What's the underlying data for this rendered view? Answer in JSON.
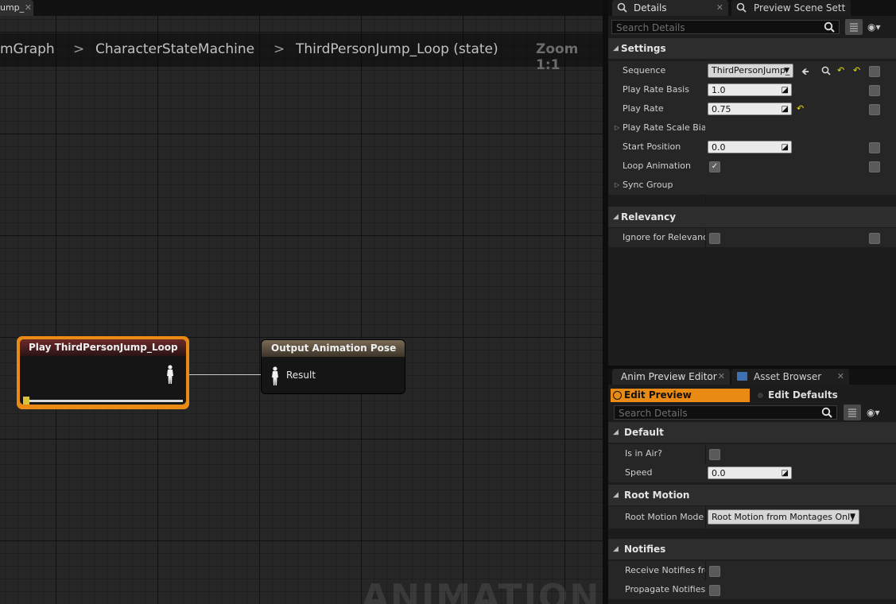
{
  "graph": {
    "tab_label": "ump_",
    "tab_close": "✕",
    "breadcrumb": [
      "mGraph",
      "CharacterStateMachine",
      "ThirdPersonJump_Loop (state)"
    ],
    "breadcrumb_sep": ">",
    "zoom": "Zoom 1:1",
    "watermark": "ANIMATION",
    "node_play_title": "Play ThirdPersonJump_Loop",
    "node_output_title": "Output Animation Pose",
    "node_output_pin": "Result"
  },
  "details_panel": {
    "tab_details": "Details",
    "tab_preview_scene": "Preview Scene Sett",
    "search_placeholder": "Search Details",
    "sections": {
      "settings": "Settings",
      "relevancy": "Relevancy"
    },
    "rows": {
      "sequence": {
        "label": "Sequence",
        "value": "ThirdPersonJump_"
      },
      "play_rate_basis": {
        "label": "Play Rate Basis",
        "value": "1.0"
      },
      "play_rate": {
        "label": "Play Rate",
        "value": "0.75"
      },
      "play_rate_scale_bias": {
        "label": "Play Rate Scale Bias"
      },
      "start_position": {
        "label": "Start Position",
        "value": "0.0"
      },
      "loop_animation": {
        "label": "Loop Animation",
        "checked": true
      },
      "sync_group": {
        "label": "Sync Group"
      },
      "ignore_for_relevancy": {
        "label": "Ignore for Relevancy",
        "checked": false
      }
    }
  },
  "anim_preview_panel": {
    "tab_anim_preview": "Anim Preview Editor",
    "tab_asset_browser": "Asset Browser",
    "edit_preview": "Edit Preview",
    "edit_defaults": "Edit Defaults",
    "search_placeholder": "Search Details",
    "sections": {
      "default": "Default",
      "root_motion": "Root Motion",
      "notifies": "Notifies"
    },
    "rows": {
      "is_in_air": {
        "label": "Is in Air?",
        "checked": false
      },
      "speed": {
        "label": "Speed",
        "value": "0.0"
      },
      "root_motion_mode": {
        "label": "Root Motion Mode",
        "value": "Root Motion from Montages Only"
      },
      "receive_notifies": {
        "label": "Receive Notifies fro",
        "checked": false
      },
      "propagate_notifies": {
        "label": "Propagate Notifies t",
        "checked": false
      }
    }
  },
  "colors": {
    "accent_orange": "#e88a14",
    "graph_bg": "#262626",
    "panel_bg": "#1c1c1c"
  }
}
